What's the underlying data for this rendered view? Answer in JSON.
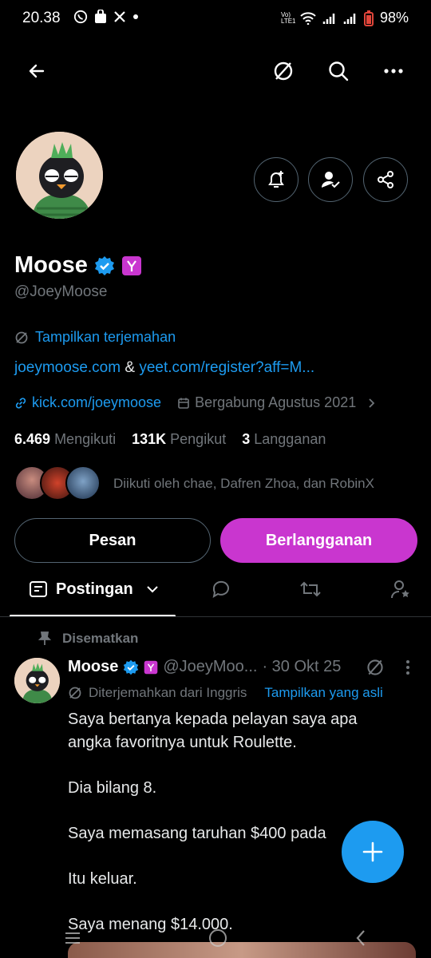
{
  "status_bar": {
    "time": "20.38",
    "battery": "98%",
    "network": "Vo) LTE1"
  },
  "profile": {
    "name": "Moose",
    "handle": "@JoeyMoose",
    "show_translation": "Tampilkan terjemahan",
    "bio_link1": "joeymoose.com",
    "bio_amp": "&",
    "bio_link2": "yeet.com/register?aff=M...",
    "website": "kick.com/joeymoose",
    "joined": "Bergabung Agustus 2021",
    "following_count": "6.469",
    "following_label": "Mengikuti",
    "followers_count": "131K",
    "followers_label": "Pengikut",
    "subscriptions_count": "3",
    "subscriptions_label": "Langganan",
    "followed_by": "Diikuti oleh chae, Dafren Zhoa, dan RobinX"
  },
  "buttons": {
    "message": "Pesan",
    "subscribe": "Berlangganan"
  },
  "tabs": {
    "posts": "Postingan"
  },
  "post": {
    "pinned_label": "Disematkan",
    "author": "Moose",
    "handle": "@JoeyMoo...",
    "date": "· 30 Okt 25",
    "translated_from": "Diterjemahkan dari Inggris",
    "show_original": "Tampilkan yang asli",
    "lines": [
      "Saya bertanya kepada pelayan saya apa",
      "angka favoritnya untuk Roulette.",
      "Dia bilang 8.",
      "Saya memasang taruhan $400 pada",
      "Itu keluar.",
      "Saya menang $14.000."
    ]
  },
  "colors": {
    "accent": "#1d9bf0",
    "subscribe": "#c936cf",
    "verified": "#1d9bf0",
    "badge": "#c936cf"
  }
}
